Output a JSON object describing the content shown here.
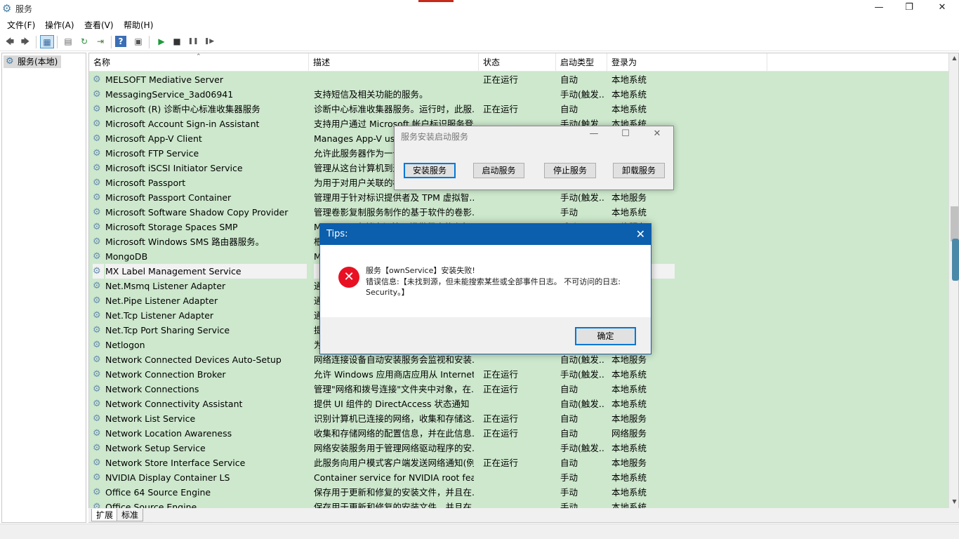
{
  "window": {
    "title": "服务",
    "minimize": "—",
    "maximize": "❐",
    "close": "✕"
  },
  "menu": [
    "文件(F)",
    "操作(A)",
    "查看(V)",
    "帮助(H)"
  ],
  "toolbar": {
    "back": "🡄",
    "forward": "🡆",
    "show_tree": "▦",
    "properties": "▤",
    "refresh": "↻",
    "export": "⇥",
    "help": "?",
    "view": "▣",
    "start": "▶",
    "stop": "■",
    "pause": "❚❚",
    "resume": "❚▶"
  },
  "tree": {
    "item": "服务(本地)"
  },
  "columns": {
    "name": "名称",
    "desc": "描述",
    "status": "状态",
    "startup": "启动类型",
    "logon": "登录为"
  },
  "services": [
    {
      "name": "MELSOFT Mediative Server",
      "desc": "",
      "status": "正在运行",
      "startup": "自动",
      "logon": "本地系统"
    },
    {
      "name": "MessagingService_3ad06941",
      "desc": "支持短信及相关功能的服务。",
      "status": "",
      "startup": "手动(触发...",
      "logon": "本地系统"
    },
    {
      "name": "Microsoft (R) 诊断中心标准收集器服务",
      "desc": "诊断中心标准收集器服务。运行时，此服...",
      "status": "正在运行",
      "startup": "自动",
      "logon": "本地系统"
    },
    {
      "name": "Microsoft Account Sign-in Assistant",
      "desc": "支持用户通过 Microsoft 帐户标识服务登...",
      "status": "",
      "startup": "手动(触发...",
      "logon": "本地系统"
    },
    {
      "name": "Microsoft App-V Client",
      "desc": "Manages App-V users and virtual applic...",
      "status": "",
      "startup": "",
      "logon": ""
    },
    {
      "name": "Microsoft FTP Service",
      "desc": "允许此服务器作为一个 FTP 服务器。",
      "status": "",
      "startup": "",
      "logon": ""
    },
    {
      "name": "Microsoft iSCSI Initiator Service",
      "desc": "管理从这台计算机到远程 iSCSI 目标设备...",
      "status": "",
      "startup": "",
      "logon": ""
    },
    {
      "name": "Microsoft Passport",
      "desc": "为用于对用户关联的标识提供者进行身份验...",
      "status": "",
      "startup": "",
      "logon": ""
    },
    {
      "name": "Microsoft Passport Container",
      "desc": "管理用于针对标识提供者及 TPM 虚拟智...",
      "status": "",
      "startup": "手动(触发...",
      "logon": "本地服务"
    },
    {
      "name": "Microsoft Software Shadow Copy Provider",
      "desc": "管理卷影复制服务制作的基于软件的卷影...",
      "status": "",
      "startup": "手动",
      "logon": "本地系统"
    },
    {
      "name": "Microsoft Storage Spaces SMP",
      "desc": "Microsoft 存储空间管理提供程序的主机...",
      "status": "",
      "startup": "手动",
      "logon": "网络服务"
    },
    {
      "name": "Microsoft Windows SMS 路由器服务。",
      "desc": "根据规则将消息路由到相应客户端。",
      "status": "",
      "startup": "",
      "logon": ""
    },
    {
      "name": "MongoDB",
      "desc": "MongoDB Database Server",
      "status": "",
      "startup": "",
      "logon": ""
    },
    {
      "name": "MX Label Management Service",
      "desc": "",
      "status": "",
      "startup": "",
      "logon": "",
      "selected": true
    },
    {
      "name": "Net.Msmq Listener Adapter",
      "desc": "通过 net.msmq 和 msmq.formatname...",
      "status": "",
      "startup": "",
      "logon": ""
    },
    {
      "name": "Net.Pipe Listener Adapter",
      "desc": "通过 net.pipe 协议接收激活请求并将其...",
      "status": "",
      "startup": "",
      "logon": ""
    },
    {
      "name": "Net.Tcp Listener Adapter",
      "desc": "通过 net.tcp 协议接收激活请求并将其...",
      "status": "",
      "startup": "",
      "logon": ""
    },
    {
      "name": "Net.Tcp Port Sharing Service",
      "desc": "提供通过 net.tcp 协议共享 TCP 端口...",
      "status": "",
      "startup": "",
      "logon": ""
    },
    {
      "name": "Netlogon",
      "desc": "为用户和服务身份验证维护此计算机和域...",
      "status": "",
      "startup": "",
      "logon": ""
    },
    {
      "name": "Network Connected Devices Auto-Setup",
      "desc": "网络连接设备自动安装服务会监视和安装...",
      "status": "",
      "startup": "自动(触发...",
      "logon": "本地服务"
    },
    {
      "name": "Network Connection Broker",
      "desc": "允许 Windows 应用商店应用从 Internet...",
      "status": "正在运行",
      "startup": "手动(触发...",
      "logon": "本地系统"
    },
    {
      "name": "Network Connections",
      "desc": "管理\"网络和拨号连接\"文件夹中对象，在...",
      "status": "正在运行",
      "startup": "自动",
      "logon": "本地系统"
    },
    {
      "name": "Network Connectivity Assistant",
      "desc": "提供 UI 组件的 DirectAccess 状态通知",
      "status": "",
      "startup": "自动(触发...",
      "logon": "本地系统"
    },
    {
      "name": "Network List Service",
      "desc": "识别计算机已连接的网络，收集和存储这...",
      "status": "正在运行",
      "startup": "自动",
      "logon": "本地服务"
    },
    {
      "name": "Network Location Awareness",
      "desc": "收集和存储网络的配置信息，并在此信息...",
      "status": "正在运行",
      "startup": "自动",
      "logon": "网络服务"
    },
    {
      "name": "Network Setup Service",
      "desc": "网络安装服务用于管理网络驱动程序的安...",
      "status": "",
      "startup": "手动(触发...",
      "logon": "本地系统"
    },
    {
      "name": "Network Store Interface Service",
      "desc": "此服务向用户模式客户端发送网络通知(例...",
      "status": "正在运行",
      "startup": "自动",
      "logon": "本地服务"
    },
    {
      "name": "NVIDIA Display Container LS",
      "desc": "Container service for NVIDIA root fea...",
      "status": "",
      "startup": "手动",
      "logon": "本地系统"
    },
    {
      "name": "Office 64 Source Engine",
      "desc": "保存用于更新和修复的安装文件，并且在...",
      "status": "",
      "startup": "手动",
      "logon": "本地系统"
    },
    {
      "name": "Office Source Engine",
      "desc": "保存用于更新和修复的安装文件，并且在...",
      "status": "",
      "startup": "手动",
      "logon": "本地系统"
    }
  ],
  "tabs": [
    "扩展",
    "标准"
  ],
  "install_dialog": {
    "title": "服务安装启动服务",
    "min": "—",
    "max": "☐",
    "close": "✕",
    "buttons": [
      "安装服务",
      "启动服务",
      "停止服务",
      "卸载服务"
    ]
  },
  "tips_dialog": {
    "title": "Tips:",
    "close": "✕",
    "icon": "✕",
    "line1": "服务【ownService】安装失败!",
    "line2": "错误信息:【未找到源，但未能搜索某些或全部事件日志。 不可访问的日志: Security。】",
    "ok": "确定"
  },
  "colors": {
    "list_bg": "#cde8cd",
    "tips_title_bg": "#0b5fad",
    "error_red": "#e81123",
    "accent": "#0078d7"
  }
}
